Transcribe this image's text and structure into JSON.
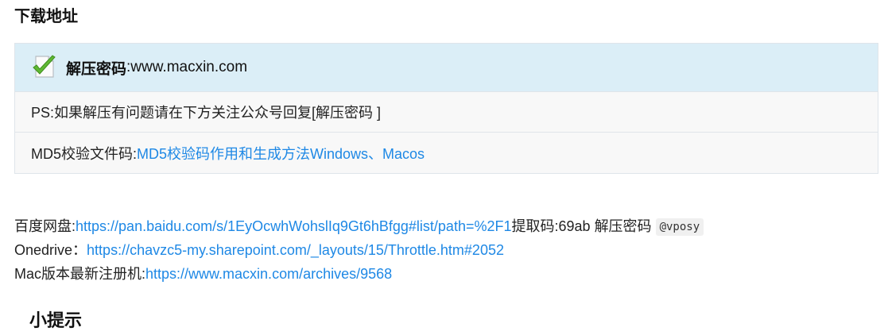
{
  "download": {
    "section_title": "下载地址",
    "password_label": "解压密码",
    "password_colon": ":",
    "password_value": "www.macxin.com",
    "ps_text": "PS:如果解压有问题请在下方关注公众号回复[解压密码 ]",
    "md5_label": "MD5校验文件码:",
    "md5_link": "MD5校验码作用和生成方法Windows、Macos"
  },
  "links": {
    "baidu_label": "百度网盘:",
    "baidu_url": "https://pan.baidu.com/s/1EyOcwhWohslIq9Gt6hBfgg#list/path=%2F1",
    "baidu_code_label": "提取码:69ab",
    "baidu_pw_label": "解压密码",
    "baidu_pw_value": "@vposy",
    "onedrive_label": "Onedrive：",
    "onedrive_url": "https://chavzc5-my.sharepoint.com/_layouts/15/Throttle.htm#2052",
    "mac_label": "Mac版本最新注册机:",
    "mac_url": "https://www.macxin.com/archives/9568"
  },
  "tips_title": "小提示",
  "colors": {
    "accent": "#1e88e5",
    "header_bg": "#dbeef7",
    "row_bg": "#f8f8f8"
  },
  "icons": [
    "check-document-icon"
  ]
}
